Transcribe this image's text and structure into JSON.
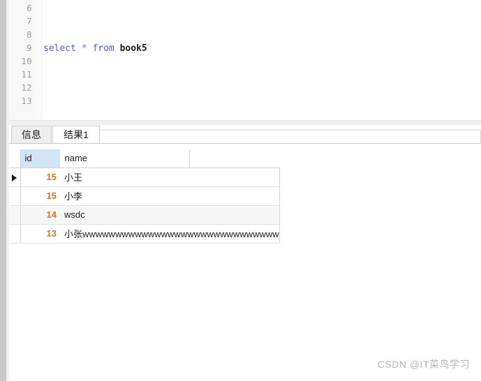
{
  "editor": {
    "lines": [
      {
        "number": "6",
        "tokens": []
      },
      {
        "number": "7",
        "tokens": []
      },
      {
        "number": "8",
        "tokens": []
      },
      {
        "number": "9",
        "text": "select * from book5",
        "tokens": [
          {
            "type": "keyword",
            "text": "select"
          },
          {
            "type": "plain",
            "text": " "
          },
          {
            "type": "operator",
            "text": "*"
          },
          {
            "type": "plain",
            "text": " "
          },
          {
            "type": "keyword",
            "text": "from"
          },
          {
            "type": "plain",
            "text": " "
          },
          {
            "type": "identifier",
            "text": "book5"
          }
        ]
      },
      {
        "number": "10",
        "tokens": []
      },
      {
        "number": "11",
        "tokens": []
      },
      {
        "number": "12",
        "tokens": []
      },
      {
        "number": "13",
        "tokens": []
      }
    ],
    "colors": {
      "keyword": "#4a5ce0",
      "operator": "#6b73d8",
      "identifier": "#202020",
      "line_number": "#999999"
    }
  },
  "tabs": [
    {
      "label": "信息",
      "active": false
    },
    {
      "label": "结果1",
      "active": true
    }
  ],
  "grid": {
    "columns": [
      {
        "key": "id",
        "label": "id",
        "selected": true
      },
      {
        "key": "name",
        "label": "name",
        "selected": false
      }
    ],
    "rows": [
      {
        "current": true,
        "id": "15",
        "name": "小王"
      },
      {
        "current": false,
        "id": "15",
        "name": "小李"
      },
      {
        "current": false,
        "id": "14",
        "name": "wsdc"
      },
      {
        "current": false,
        "id": "13",
        "name": "小张wwwwwwwwwwwwwwwwwwwwwwwwwwwwww"
      }
    ],
    "row_count": 4,
    "current_row_marker": "▶",
    "colors": {
      "selected_header": "#d4e4f7",
      "numeric_value": "#c77b1f",
      "alt_row": "#f7f7f7",
      "grid_line": "#d5d5d5"
    }
  },
  "watermark": {
    "text": "CSDN @IT菜鸟学习"
  }
}
